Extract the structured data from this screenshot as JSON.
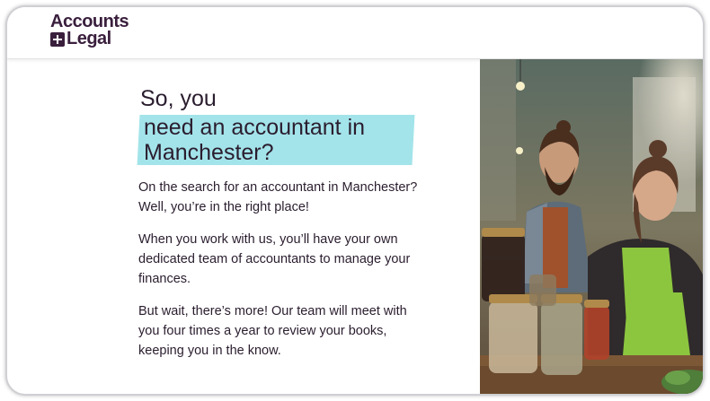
{
  "logo": {
    "line1": "Accounts",
    "line2": "Legal"
  },
  "hero": {
    "title_line1": "So, you",
    "title_highlight_1": "need an accountant in",
    "title_highlight_2": "Manchester?"
  },
  "paragraphs": [
    "On the search for an accountant in Manchester? Well, you’re in the right place!",
    "When you work with us, you’ll have your own dedicated team of accountants to manage your finances.",
    "But wait, there’s more! Our team will meet with you four times a year to review your books, keeping you in the know."
  ],
  "colors": {
    "brand": "#3a1f3d",
    "highlight": "#a3e4ea",
    "apron": "#8cc63f"
  }
}
